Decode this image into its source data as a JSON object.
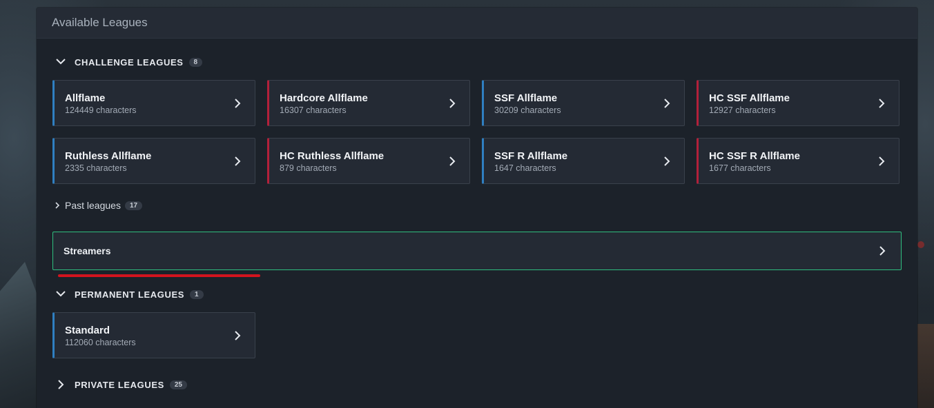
{
  "panel": {
    "title": "Available Leagues"
  },
  "challenge": {
    "label": "CHALLENGE LEAGUES",
    "count": "8",
    "leagues": [
      {
        "name": "Allflame",
        "count": "124449 characters",
        "kind": "softcore"
      },
      {
        "name": "Hardcore Allflame",
        "count": "16307 characters",
        "kind": "hardcore"
      },
      {
        "name": "SSF Allflame",
        "count": "30209 characters",
        "kind": "softcore"
      },
      {
        "name": "HC SSF Allflame",
        "count": "12927 characters",
        "kind": "hardcore"
      },
      {
        "name": "Ruthless Allflame",
        "count": "2335 characters",
        "kind": "softcore"
      },
      {
        "name": "HC Ruthless Allflame",
        "count": "879 characters",
        "kind": "hardcore"
      },
      {
        "name": "SSF R Allflame",
        "count": "1647 characters",
        "kind": "softcore"
      },
      {
        "name": "HC SSF R Allflame",
        "count": "1677 characters",
        "kind": "hardcore"
      }
    ]
  },
  "past": {
    "label": "Past leagues",
    "count": "17"
  },
  "streamers": {
    "label": "Streamers"
  },
  "permanent": {
    "label": "PERMANENT LEAGUES",
    "count": "1",
    "leagues": [
      {
        "name": "Standard",
        "count": "112060 characters",
        "kind": "softcore"
      }
    ]
  },
  "private": {
    "label": "PRIVATE LEAGUES",
    "count": "25"
  },
  "colors": {
    "softcore_accent": "#2f7fc1",
    "hardcore_accent": "#b3203a",
    "highlight_border": "#2fbf7f",
    "annotation_underline": "#d2141e"
  },
  "icons": {
    "section_expanded": "chevron-down-icon",
    "section_collapsed": "chevron-right-icon",
    "card_arrow": "chevron-right-icon"
  }
}
